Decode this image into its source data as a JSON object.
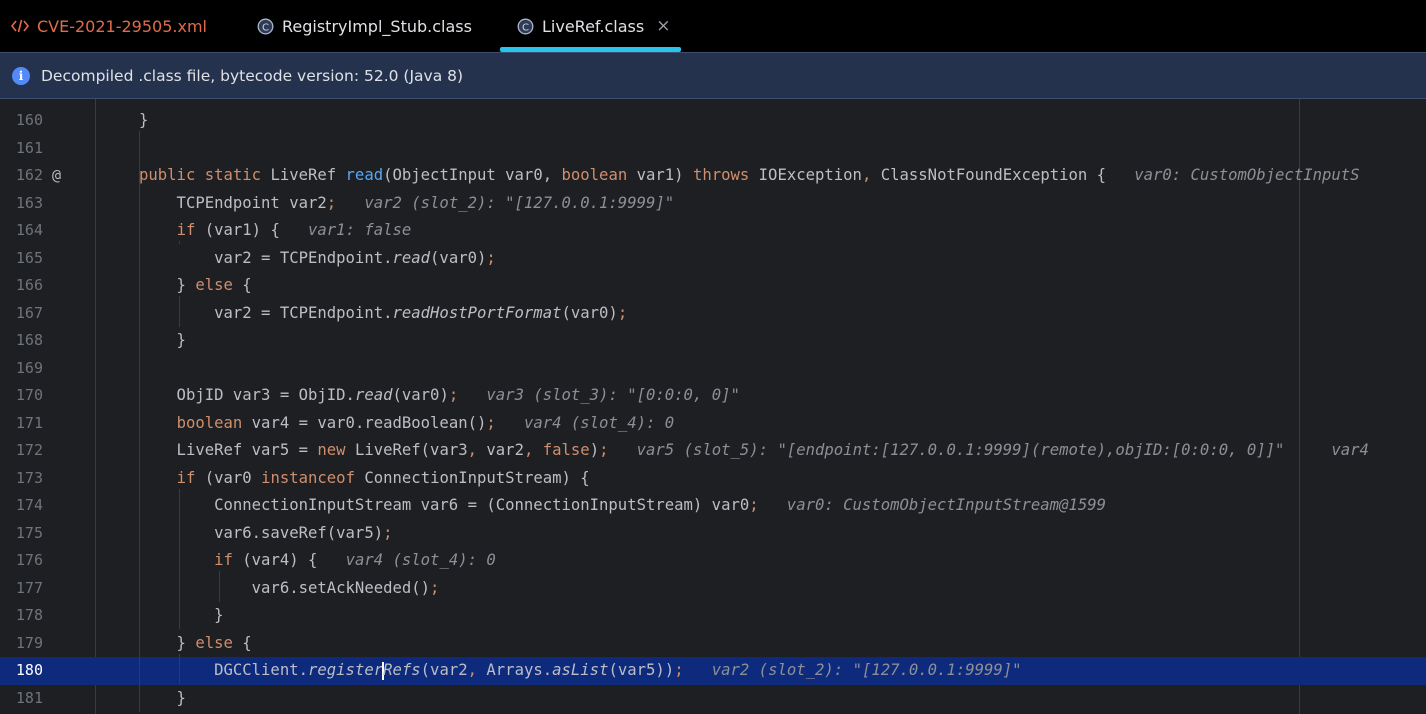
{
  "tabs": [
    {
      "label": "CVE-2021-29505.xml",
      "icon": "xml-file-icon",
      "active": false,
      "color": "#e06c4b"
    },
    {
      "label": "RegistryImpl_Stub.class",
      "icon": "class-file-icon",
      "active": false
    },
    {
      "label": "LiveRef.class",
      "icon": "class-file-icon",
      "active": true,
      "close": "×"
    }
  ],
  "banner": {
    "icon": "i",
    "text": "Decompiled .class file, bytecode version: 52.0 (Java 8)"
  },
  "colors": {
    "accent": "#28c4ec",
    "keyword": "#cf8e6d",
    "method": "#56a8f5",
    "hint": "#8c8f96",
    "current_line": "#0d2a7d"
  },
  "editor": {
    "lines": [
      {
        "n": "160",
        "parts": [
          {
            "t": "}"
          }
        ]
      },
      {
        "n": "161",
        "parts": []
      },
      {
        "n": "162",
        "gutter": "@",
        "parts": [
          {
            "t": "public static ",
            "c": "kw"
          },
          {
            "t": "LiveRef "
          },
          {
            "t": "read",
            "c": "fn"
          },
          {
            "t": "(ObjectInput var0, "
          },
          {
            "t": "boolean ",
            "c": "kw"
          },
          {
            "t": "var1) "
          },
          {
            "t": "throws ",
            "c": "kw"
          },
          {
            "t": "IOException"
          },
          {
            "t": ", ",
            "c": "kw"
          },
          {
            "t": "ClassNotFoundException {   "
          },
          {
            "t": "var0: CustomObjectInputS",
            "c": "hint"
          }
        ]
      },
      {
        "n": "163",
        "parts": [
          {
            "t": "    TCPEndpoint var2"
          },
          {
            "t": ";",
            "c": "kw"
          },
          {
            "t": "   var2 (slot_2): \"[127.0.0.1:9999]\"",
            "c": "hint"
          }
        ]
      },
      {
        "n": "164",
        "parts": [
          {
            "t": "    "
          },
          {
            "t": "if ",
            "c": "kw"
          },
          {
            "t": "(var1) {   "
          },
          {
            "t": "var1: false",
            "c": "hint"
          }
        ]
      },
      {
        "n": "165",
        "parts": [
          {
            "t": "        var2 = TCPEndpoint."
          },
          {
            "t": "read",
            "c": "it"
          },
          {
            "t": "(var0)"
          },
          {
            "t": ";",
            "c": "kw"
          }
        ]
      },
      {
        "n": "166",
        "parts": [
          {
            "t": "    } "
          },
          {
            "t": "else ",
            "c": "kw"
          },
          {
            "t": "{"
          }
        ]
      },
      {
        "n": "167",
        "parts": [
          {
            "t": "        var2 = TCPEndpoint."
          },
          {
            "t": "readHostPortFormat",
            "c": "it"
          },
          {
            "t": "(var0)"
          },
          {
            "t": ";",
            "c": "kw"
          }
        ]
      },
      {
        "n": "168",
        "parts": [
          {
            "t": "    }"
          }
        ]
      },
      {
        "n": "169",
        "parts": []
      },
      {
        "n": "170",
        "parts": [
          {
            "t": "    ObjID var3 = ObjID."
          },
          {
            "t": "read",
            "c": "it"
          },
          {
            "t": "(var0)"
          },
          {
            "t": ";",
            "c": "kw"
          },
          {
            "t": "   var3 (slot_3): \"[0:0:0, 0]\"",
            "c": "hint"
          }
        ]
      },
      {
        "n": "171",
        "parts": [
          {
            "t": "    "
          },
          {
            "t": "boolean ",
            "c": "kw"
          },
          {
            "t": "var4 = var0.readBoolean()"
          },
          {
            "t": ";",
            "c": "kw"
          },
          {
            "t": "   var4 (slot_4): 0",
            "c": "hint"
          }
        ]
      },
      {
        "n": "172",
        "parts": [
          {
            "t": "    LiveRef var5 = "
          },
          {
            "t": "new ",
            "c": "kw"
          },
          {
            "t": "LiveRef(var3"
          },
          {
            "t": ", ",
            "c": "kw"
          },
          {
            "t": "var2"
          },
          {
            "t": ", false",
            "c": "kw"
          },
          {
            "t": ")"
          },
          {
            "t": ";",
            "c": "kw"
          },
          {
            "t": "   var5 (slot_5): \"[endpoint:[127.0.0.1:9999](remote),objID:[0:0:0, 0]]\"     var4",
            "c": "hint"
          }
        ]
      },
      {
        "n": "173",
        "parts": [
          {
            "t": "    "
          },
          {
            "t": "if ",
            "c": "kw"
          },
          {
            "t": "(var0 "
          },
          {
            "t": "instanceof ",
            "c": "kw"
          },
          {
            "t": "ConnectionInputStream) {"
          }
        ]
      },
      {
        "n": "174",
        "parts": [
          {
            "t": "        ConnectionInputStream var6 = (ConnectionInputStream) var0"
          },
          {
            "t": ";",
            "c": "kw"
          },
          {
            "t": "   var0: CustomObjectInputStream@1599",
            "c": "hint"
          }
        ]
      },
      {
        "n": "175",
        "parts": [
          {
            "t": "        var6.saveRef(var5)"
          },
          {
            "t": ";",
            "c": "kw"
          }
        ]
      },
      {
        "n": "176",
        "parts": [
          {
            "t": "        "
          },
          {
            "t": "if ",
            "c": "kw"
          },
          {
            "t": "(var4) {   "
          },
          {
            "t": "var4 (slot_4): 0",
            "c": "hint"
          }
        ]
      },
      {
        "n": "177",
        "parts": [
          {
            "t": "            var6.setAckNeeded()"
          },
          {
            "t": ";",
            "c": "kw"
          }
        ]
      },
      {
        "n": "178",
        "parts": [
          {
            "t": "        }"
          }
        ]
      },
      {
        "n": "179",
        "parts": [
          {
            "t": "    } "
          },
          {
            "t": "else ",
            "c": "kw"
          },
          {
            "t": "{"
          }
        ]
      },
      {
        "n": "180",
        "current": true,
        "parts": [
          {
            "t": "        DGCClient."
          },
          {
            "t": "register",
            "c": "it"
          },
          {
            "caret": true
          },
          {
            "t": "Refs",
            "c": "it"
          },
          {
            "t": "(var2"
          },
          {
            "t": ", ",
            "c": "kw"
          },
          {
            "t": "Arrays."
          },
          {
            "t": "asList",
            "c": "it"
          },
          {
            "t": "(var5))"
          },
          {
            "t": ";",
            "c": "kw"
          },
          {
            "t": "   var2 (slot_2): \"[127.0.0.1:9999]\"",
            "c": "hint"
          }
        ]
      },
      {
        "n": "181",
        "parts": [
          {
            "t": "    }"
          }
        ]
      }
    ]
  }
}
